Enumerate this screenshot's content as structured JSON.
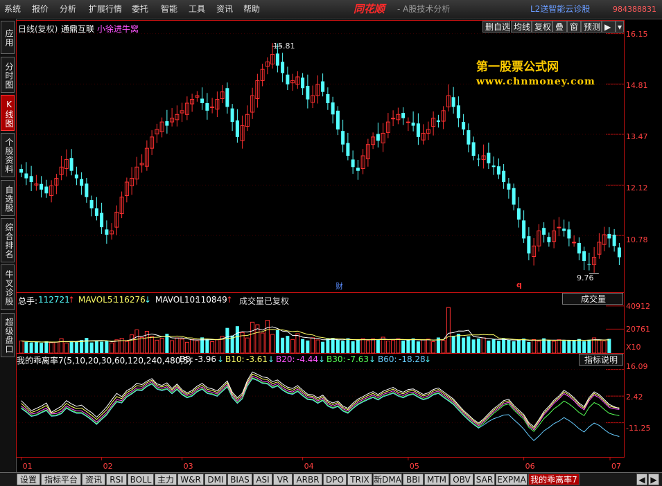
{
  "menu": [
    "系统",
    "报价",
    "分析",
    "扩展行情",
    "委托",
    "智能",
    "工具",
    "资讯",
    "帮助"
  ],
  "brand": "同花顺",
  "subtitle": "- A股技术分析",
  "l2_link": "L2送智能云诊股",
  "phone": "984388831",
  "sidebar_tabs": [
    {
      "label": "应用",
      "active": false
    },
    {
      "label": "分时图",
      "active": false
    },
    {
      "label": "K线图",
      "active": true
    },
    {
      "label": "个股资料",
      "active": false
    },
    {
      "label": "自选股",
      "active": false
    },
    {
      "label": "综合排名",
      "active": false
    },
    {
      "label": "牛叉诊股",
      "active": false
    },
    {
      "label": "超级盘口",
      "active": false
    }
  ],
  "kline_header": {
    "period": "日线(复权)",
    "stock": "通鼎互联",
    "author": "小徐进牛窝"
  },
  "toolbar": [
    "删自选",
    "均线",
    "复权",
    "叠",
    "窗",
    "预测"
  ],
  "watermark": {
    "line1": "第一股票公式网",
    "line2": "www.chnmoney.com"
  },
  "price_axis": [
    "16.15",
    "14.81",
    "13.47",
    "12.12",
    "10.78"
  ],
  "high_label": "15.81",
  "low_label": "9.76",
  "markers": {
    "cai": "财",
    "q": "q"
  },
  "volume_header": {
    "total_label": "总手:",
    "total_value": "112721",
    "mavol5_label": "MAVOL5:",
    "mavol5_value": "116276",
    "mavol10_label": "MAVOL10:",
    "mavol10_value": "110849",
    "note": "成交量已复权",
    "dropdown": "成交量"
  },
  "volume_axis": [
    "40912",
    "20761"
  ],
  "volume_unit": "X10",
  "indicator_header": {
    "name": "我的乖离率7(5,10,20,30,60,120,240,480,5)",
    "b5_label": "B5:",
    "b5_value": "-3.96",
    "b10_label": "B10:",
    "b10_value": "-3.61",
    "b20_label": "B20:",
    "b20_value": "-4.44",
    "b30_label": "B30:",
    "b30_value": "-7.63",
    "b60_label": "B60:",
    "b60_value": "-18.28",
    "help": "指标说明"
  },
  "indicator_axis": [
    "16.09",
    "2.42",
    "-11.25"
  ],
  "months": [
    "01",
    "02",
    "03",
    "04",
    "05",
    "06",
    "07"
  ],
  "bottom_tabs": [
    "设置",
    "指标平台",
    "资讯",
    "RSI",
    "BOLL",
    "主力",
    "W&R",
    "DMI",
    "BIAS",
    "ASI",
    "VR",
    "ARBR",
    "DPO",
    "TRIX",
    "新DMA",
    "BBI",
    "MTM",
    "OBV",
    "SAR",
    "EXPMA",
    "我的乖离率7"
  ],
  "active_bottom_tab": "我的乖离率7",
  "colors": {
    "up": "#ff3030",
    "down": "#54ffff",
    "axis": "#c01010",
    "b5": "#ffffff",
    "b10": "#ffff66",
    "b20": "#ff55ff",
    "b30": "#55ff55",
    "b60": "#66ccff"
  },
  "chart_data": [
    {
      "type": "candlestick",
      "title": "通鼎互联 日线(复权)",
      "ylim": [
        9.4,
        16.4
      ],
      "x_ticks": [
        "01",
        "02",
        "03",
        "04",
        "05",
        "06",
        "07"
      ],
      "price_ticks": [
        16.15,
        14.81,
        13.47,
        12.12,
        10.78
      ],
      "high": 15.81,
      "low": 9.76,
      "close": [
        12.45,
        12.3,
        12.2,
        12.15,
        12.0,
        11.9,
        12.1,
        12.3,
        12.6,
        12.8,
        12.5,
        12.3,
        12.1,
        11.8,
        11.5,
        11.3,
        11.0,
        10.8,
        10.9,
        11.4,
        11.8,
        12.2,
        12.3,
        12.6,
        12.7,
        13.1,
        13.4,
        13.6,
        13.8,
        13.7,
        13.9,
        14.0,
        14.1,
        14.3,
        14.4,
        14.5,
        14.3,
        14.1,
        14.2,
        14.4,
        14.6,
        14.2,
        13.8,
        13.4,
        13.7,
        14.0,
        14.5,
        14.9,
        15.2,
        15.4,
        15.6,
        15.3,
        15.1,
        14.8,
        14.9,
        15.0,
        14.7,
        14.4,
        14.5,
        14.8,
        14.6,
        14.3,
        14.0,
        13.6,
        13.2,
        12.9,
        12.6,
        12.5,
        12.9,
        13.2,
        13.4,
        13.3,
        13.5,
        13.8,
        13.9,
        14.0,
        13.9,
        13.8,
        13.7,
        13.4,
        13.5,
        13.6,
        13.9,
        13.8,
        14.1,
        14.5,
        14.2,
        13.9,
        13.6,
        13.2,
        12.9,
        12.8,
        12.9,
        12.7,
        12.6,
        12.4,
        12.2,
        12.0,
        11.6,
        11.2,
        10.7,
        10.3,
        10.5,
        10.9,
        10.8,
        10.6,
        10.9,
        11.0,
        10.9,
        10.7,
        10.6,
        10.3,
        10.1,
        10.0,
        10.2,
        10.6,
        10.8,
        10.7,
        10.5,
        10.2
      ],
      "volume_ylim": [
        0,
        45000
      ],
      "volume_ticks": [
        40912,
        20761
      ],
      "volume": [
        10500,
        9800,
        9200,
        9700,
        8900,
        10200,
        9000,
        9500,
        12500,
        8700,
        10400,
        9600,
        11300,
        13200,
        9200,
        10800,
        9900,
        10600,
        8800,
        11500,
        12800,
        10200,
        15800,
        20100,
        13600,
        18900,
        14300,
        11200,
        12900,
        16700,
        10800,
        13200,
        12100,
        9400,
        11700,
        10500,
        13600,
        12300,
        9900,
        11800,
        14500,
        21800,
        15200,
        23300,
        17800,
        13100,
        26800,
        24600,
        17400,
        28500,
        16200,
        19800,
        13300,
        14900,
        11800,
        16800,
        12200,
        10900,
        13300,
        11400,
        9800,
        12300,
        13100,
        11600,
        10700,
        12800,
        10200,
        11800,
        12500,
        10700,
        12300,
        11600,
        13800,
        10500,
        11200,
        12400,
        10900,
        11300,
        12700,
        10100,
        11500,
        12100,
        9900,
        13500,
        11000,
        39500,
        14800,
        16700,
        13400,
        14500,
        11800,
        12600,
        13200,
        10800,
        11900,
        10700,
        12500,
        11400,
        10200,
        11300,
        12600,
        9600,
        11700,
        10300,
        12800,
        11100,
        10200,
        11600,
        10700,
        11100,
        10900,
        12200,
        10300,
        11500,
        13200,
        11100,
        10500,
        12300
      ]
    },
    {
      "type": "line",
      "title": "我的乖离率7(5,10,20,30,60,120,240,480,5)",
      "ylim": [
        -27,
        22
      ],
      "y_ticks": [
        16.09,
        2.42,
        -11.25
      ],
      "series": [
        {
          "name": "B5",
          "last": -3.96,
          "values": [
            0.1,
            -2.5,
            -5.1,
            -3.9,
            -2.7,
            -1.1,
            -5.9,
            -4.3,
            -2.8,
            0.1,
            -1.6,
            -2.8,
            -2.2,
            -4.3,
            -6.0,
            -8.4,
            -5.9,
            -3.1,
            0.5,
            3.8,
            2.1,
            5.2,
            6.6,
            9.0,
            8.3,
            10.1,
            11.4,
            8.7,
            7.9,
            9.2,
            6.3,
            8.6,
            5.7,
            4.1,
            5.3,
            7.5,
            8.9,
            6.8,
            6.1,
            5.1,
            7.6,
            10.2,
            4.4,
            1.6,
            3.9,
            10.5,
            14.8,
            13.6,
            12.3,
            11.8,
            9.8,
            10.7,
            8.6,
            7.0,
            6.3,
            7.8,
            5.5,
            3.4,
            3.1,
            1.5,
            2.9,
            0.1,
            -1.1,
            -0.1,
            -2.7,
            -3.8,
            -1.2,
            0.9,
            2.2,
            3.6,
            4.7,
            3.2,
            4.9,
            5.9,
            6.9,
            5.3,
            4.4,
            5.8,
            6.1,
            4.7,
            3.3,
            4.1,
            5.8,
            6.6,
            4.7,
            2.8,
            0.9,
            -2.1,
            -4.9,
            -7.2,
            -9.6,
            -11.4,
            -9.3,
            -6.6,
            -4.0,
            -2.1,
            0.1,
            0.8,
            -2.3,
            -4.7,
            -7.0,
            -11.2,
            -13.3,
            -9.6,
            -5.5,
            -2.8,
            0.3,
            2.5,
            5.4,
            3.8,
            1.6,
            -1.2,
            -3.0,
            1.7,
            4.6,
            3.2,
            0.7,
            -1.8,
            -3.0,
            -4.0
          ]
        },
        {
          "name": "B10",
          "last": -3.61,
          "values": [
            -1.3,
            -3.6,
            -6.0,
            -5.1,
            -3.8,
            -2.4,
            -6.3,
            -5.4,
            -4.1,
            -1.3,
            -2.9,
            -4.0,
            -3.7,
            -5.5,
            -7.4,
            -9.6,
            -7.1,
            -4.6,
            -1.0,
            2.2,
            1.1,
            4.2,
            5.7,
            7.8,
            7.4,
            9.3,
            10.6,
            8.0,
            7.1,
            8.2,
            5.6,
            7.8,
            5.0,
            3.4,
            4.5,
            6.6,
            8.0,
            5.9,
            5.3,
            4.3,
            6.8,
            9.3,
            3.6,
            0.8,
            3.0,
            9.6,
            13.7,
            12.6,
            11.2,
            10.8,
            8.8,
            9.7,
            7.6,
            6.1,
            5.4,
            6.9,
            4.6,
            2.6,
            2.3,
            0.7,
            2.1,
            -0.7,
            -1.9,
            -0.9,
            -3.4,
            -4.5,
            -2.0,
            0.1,
            1.4,
            2.7,
            3.8,
            2.4,
            4.1,
            5.0,
            6.0,
            4.4,
            3.6,
            4.9,
            5.3,
            3.9,
            2.5,
            3.3,
            5.0,
            5.8,
            3.9,
            2.0,
            0.1,
            -2.8,
            -5.6,
            -7.9,
            -10.2,
            -12.1,
            -10.0,
            -7.4,
            -4.8,
            -2.9,
            -0.7,
            0.0,
            -3.1,
            -5.5,
            -7.8,
            -12.0,
            -14.1,
            -10.4,
            -6.3,
            -3.6,
            -0.5,
            1.7,
            4.6,
            3.0,
            0.8,
            -2.0,
            -3.8,
            0.9,
            3.8,
            2.4,
            -0.1,
            -2.6,
            -3.4,
            -3.6
          ]
        },
        {
          "name": "B20",
          "last": -4.44,
          "values": [
            -2.7,
            -4.6,
            -6.8,
            -6.3,
            -5.0,
            -3.8,
            -6.7,
            -6.5,
            -5.4,
            -2.6,
            -4.1,
            -5.2,
            -5.2,
            -6.8,
            -8.7,
            -10.9,
            -8.4,
            -6.1,
            -2.5,
            0.6,
            0.1,
            3.1,
            4.7,
            6.6,
            6.4,
            8.5,
            9.8,
            7.2,
            6.4,
            7.2,
            4.8,
            7.0,
            4.3,
            2.7,
            3.6,
            5.8,
            7.1,
            5.0,
            4.4,
            3.5,
            6.0,
            8.3,
            2.8,
            -0.1,
            2.2,
            8.7,
            12.6,
            11.6,
            10.1,
            9.8,
            7.8,
            8.8,
            6.6,
            5.1,
            4.5,
            6.0,
            3.7,
            1.8,
            1.6,
            -0.1,
            1.3,
            -1.5,
            -2.7,
            -1.7,
            -4.1,
            -5.2,
            -2.8,
            -0.8,
            0.6,
            1.8,
            2.9,
            1.6,
            3.3,
            4.1,
            5.1,
            3.6,
            2.7,
            4.0,
            4.5,
            3.0,
            1.7,
            2.5,
            4.2,
            5.0,
            3.0,
            1.2,
            -0.7,
            -3.5,
            -6.3,
            -8.7,
            -10.9,
            -12.8,
            -10.7,
            -8.1,
            -5.6,
            -3.7,
            -1.5,
            -0.8,
            -3.9,
            -6.3,
            -8.6,
            -12.8,
            -14.9,
            -11.2,
            -7.1,
            -4.4,
            -1.3,
            0.9,
            3.7,
            2.2,
            0.0,
            -2.8,
            -4.6,
            0.1,
            3.0,
            1.6,
            -0.9,
            -3.4,
            -4.1,
            -4.4
          ]
        },
        {
          "name": "B30",
          "last": -7.63,
          "values": [
            -3.5,
            -5.4,
            -7.6,
            -7.1,
            -5.8,
            -4.6,
            -7.5,
            -7.3,
            -6.2,
            -3.4,
            -4.9,
            -6.0,
            -6.0,
            -7.6,
            -9.5,
            -11.7,
            -9.2,
            -6.9,
            -3.3,
            -0.2,
            -0.7,
            2.3,
            3.9,
            5.8,
            5.6,
            7.7,
            9.0,
            6.4,
            5.6,
            6.4,
            4.0,
            6.2,
            3.5,
            1.9,
            2.8,
            5.0,
            6.3,
            4.2,
            3.6,
            2.7,
            5.2,
            7.5,
            2.0,
            -0.9,
            1.4,
            7.9,
            11.8,
            10.8,
            9.3,
            9.0,
            7.0,
            8.0,
            5.8,
            4.3,
            3.7,
            5.2,
            2.9,
            1.0,
            0.8,
            -0.9,
            0.5,
            -2.3,
            -3.5,
            -2.5,
            -4.9,
            -6.0,
            -3.6,
            -1.6,
            -0.2,
            1.0,
            2.1,
            0.8,
            2.5,
            3.3,
            4.3,
            2.8,
            1.9,
            3.2,
            3.7,
            2.2,
            0.9,
            1.7,
            3.4,
            4.2,
            2.2,
            0.4,
            -1.5,
            -4.3,
            -7.1,
            -9.5,
            -11.7,
            -13.6,
            -11.5,
            -8.9,
            -6.4,
            -4.5,
            -2.3,
            -1.6,
            -4.7,
            -7.1,
            -9.4,
            -13.6,
            -15.7,
            -12.6,
            -9.1,
            -6.8,
            -4.1,
            -2.3,
            -0.1,
            -1.6,
            -3.6,
            -6.0,
            -7.6,
            -3.4,
            -0.9,
            -2.1,
            -4.4,
            -6.4,
            -7.1,
            -7.6
          ]
        },
        {
          "name": "B60",
          "last": -18.28,
          "values": [
            -3.9,
            -5.8,
            -8.0,
            -7.5,
            -6.2,
            -5.0,
            -7.9,
            -7.7,
            -6.6,
            -3.8,
            -5.3,
            -6.4,
            -6.4,
            -8.0,
            -9.9,
            -12.1,
            -9.6,
            -7.3,
            -3.7,
            -0.6,
            -1.1,
            1.9,
            3.5,
            5.4,
            5.2,
            7.3,
            8.6,
            6.0,
            5.2,
            6.0,
            3.6,
            5.8,
            3.1,
            1.5,
            2.4,
            4.6,
            5.9,
            3.8,
            3.2,
            2.3,
            4.8,
            7.1,
            1.6,
            -1.3,
            1.0,
            7.5,
            11.4,
            10.4,
            8.9,
            8.6,
            6.6,
            7.6,
            5.4,
            3.9,
            3.3,
            4.8,
            2.5,
            0.6,
            0.4,
            -1.3,
            0.1,
            -2.7,
            -3.9,
            -2.9,
            -5.3,
            -6.4,
            -4.0,
            -2.0,
            -0.6,
            0.6,
            1.7,
            0.4,
            2.1,
            2.9,
            3.9,
            2.4,
            1.5,
            2.8,
            3.3,
            1.8,
            0.5,
            1.3,
            3.0,
            3.8,
            1.8,
            0.0,
            -1.9,
            -4.7,
            -7.5,
            -9.9,
            -12.1,
            -14.0,
            -12.4,
            -10.6,
            -9.2,
            -8.3,
            -7.3,
            -7.1,
            -9.6,
            -11.9,
            -14.5,
            -17.8,
            -20.4,
            -18.1,
            -15.4,
            -13.7,
            -11.7,
            -10.4,
            -8.6,
            -10.1,
            -12.0,
            -14.3,
            -16.0,
            -13.3,
            -11.4,
            -12.6,
            -14.7,
            -16.6,
            -17.6,
            -18.3
          ]
        }
      ]
    }
  ]
}
